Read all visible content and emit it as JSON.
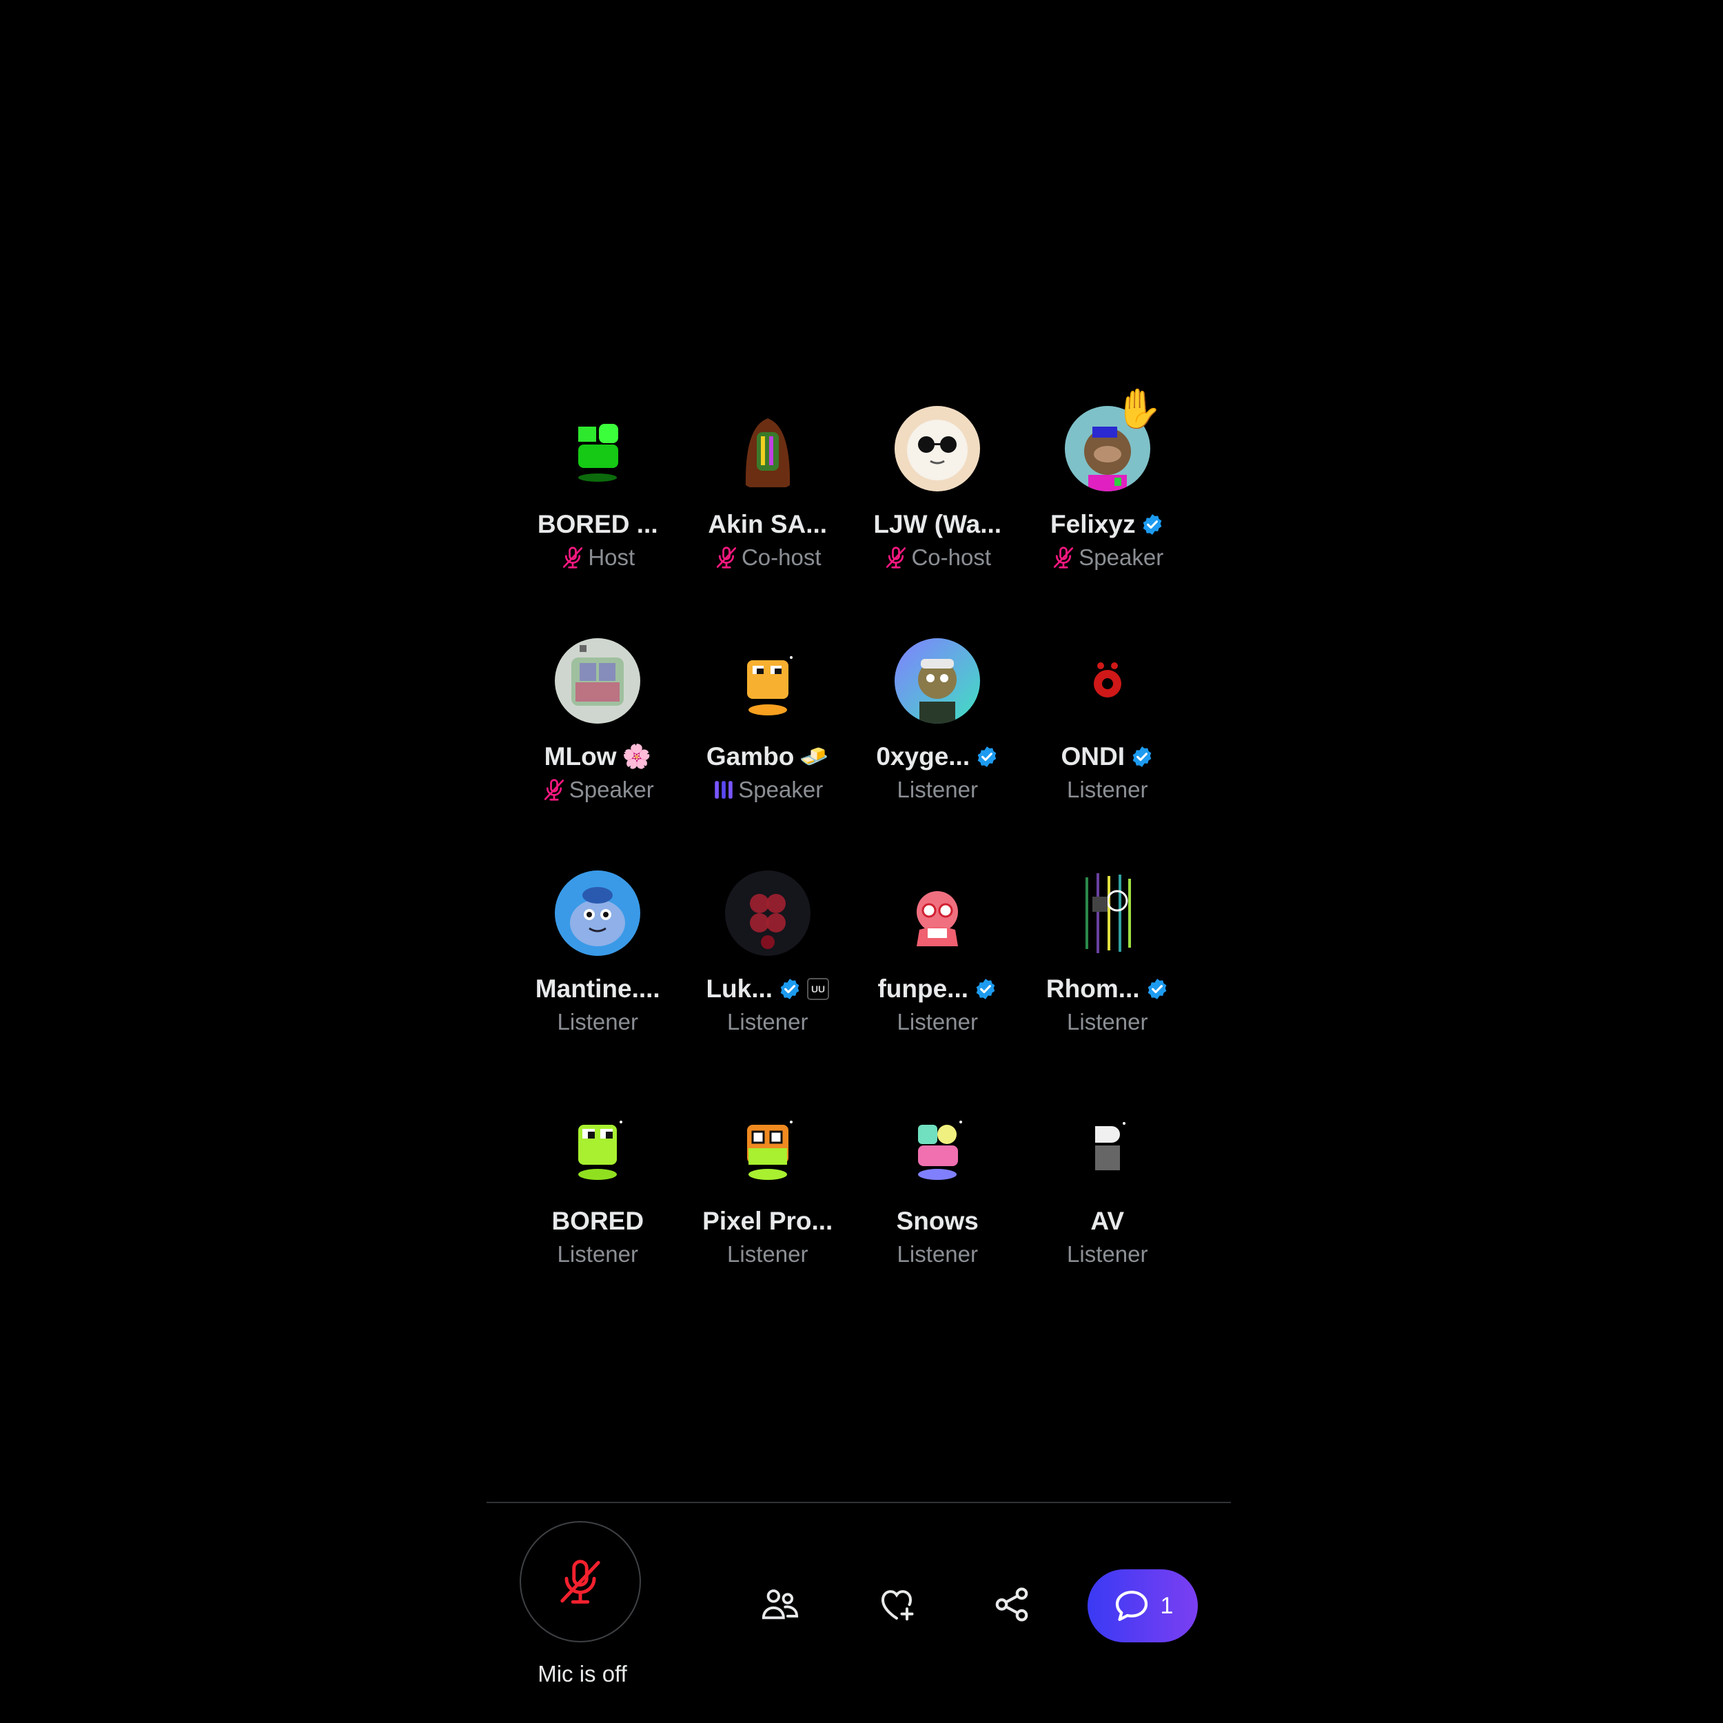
{
  "participants": [
    {
      "name": "BORED ...",
      "role": "Host",
      "role_icon": "mic-off",
      "verified": false
    },
    {
      "name": "Akin SA...",
      "role": "Co-host",
      "role_icon": "mic-off",
      "verified": false
    },
    {
      "name": "LJW (Wa...",
      "role": "Co-host",
      "role_icon": "mic-off",
      "verified": false
    },
    {
      "name": "Felixyz",
      "role": "Speaker",
      "role_icon": "mic-off",
      "verified": true,
      "hand_raised": true
    },
    {
      "name": "MLow",
      "emoji": "🌸",
      "role": "Speaker",
      "role_icon": "mic-off",
      "verified": false
    },
    {
      "name": "Gambo",
      "emoji": "🧈",
      "role": "Speaker",
      "role_icon": "talking",
      "verified": false
    },
    {
      "name": "0xyge...",
      "role": "Listener",
      "verified": true
    },
    {
      "name": "ONDI",
      "role": "Listener",
      "verified": true
    },
    {
      "name": "Mantine....",
      "role": "Listener",
      "verified": false
    },
    {
      "name": "Luk...",
      "role": "Listener",
      "verified": true,
      "badge": "UU"
    },
    {
      "name": "funpe...",
      "role": "Listener",
      "verified": true
    },
    {
      "name": "Rhom...",
      "role": "Listener",
      "verified": true
    },
    {
      "name": "BORED",
      "role": "Listener",
      "verified": false
    },
    {
      "name": "Pixel Pro...",
      "role": "Listener",
      "verified": false
    },
    {
      "name": "Snows",
      "role": "Listener",
      "verified": false
    },
    {
      "name": "AV",
      "role": "Listener",
      "verified": false
    }
  ],
  "controls": {
    "mic_label": "Mic is off",
    "chat_count": "1"
  },
  "colors": {
    "verified": "#1d9bf0",
    "mic_off": "#f4212e",
    "talking": "#7856ff",
    "chat_gradient_start": "#3a3af4",
    "chat_gradient_end": "#7b3ff2"
  }
}
